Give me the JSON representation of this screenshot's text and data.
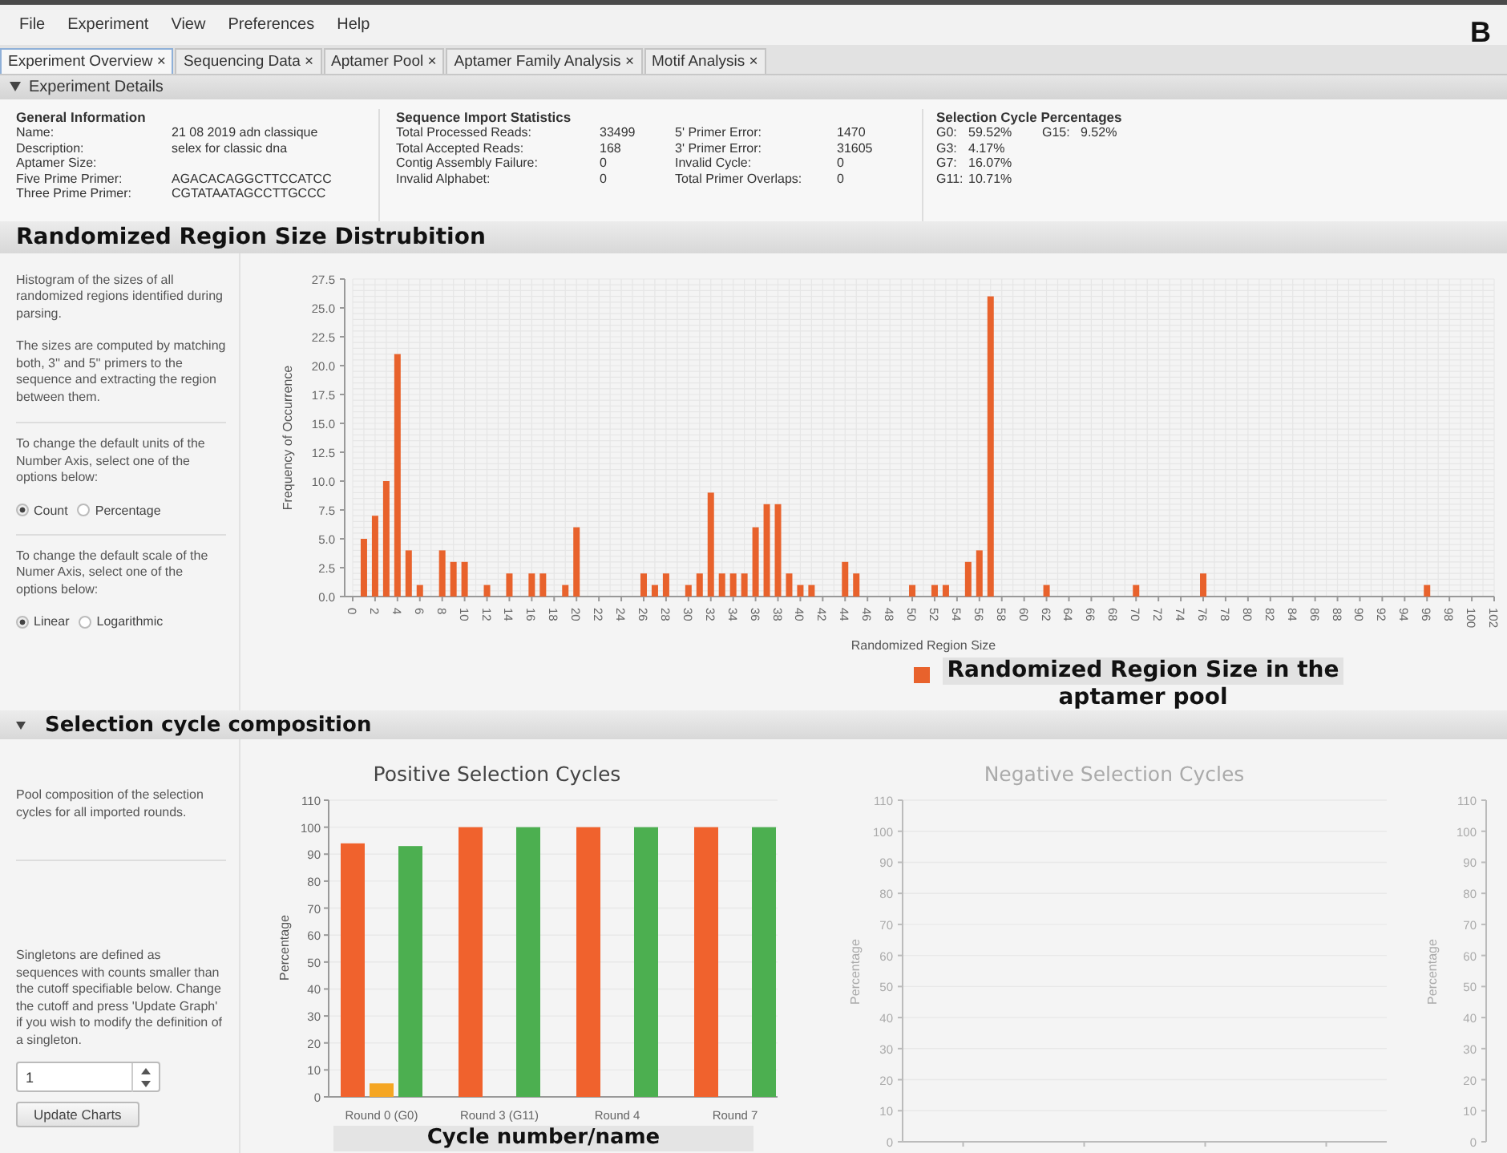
{
  "menu": [
    "File",
    "Experiment",
    "View",
    "Preferences",
    "Help"
  ],
  "panel_letter": "B",
  "tabs": [
    {
      "label": "Experiment Overview",
      "close": "×",
      "selected": true
    },
    {
      "label": "Sequencing Data",
      "close": "×",
      "selected": false
    },
    {
      "label": "Aptamer Pool",
      "close": "×",
      "selected": false
    },
    {
      "label": "Aptamer Family Analysis",
      "close": "×",
      "selected": false
    },
    {
      "label": "Motif Analysis",
      "close": "×",
      "selected": false
    }
  ],
  "details": {
    "title": "Experiment Details",
    "expanded": true,
    "general": {
      "title": "General Information",
      "rows": [
        {
          "label": "Name:",
          "value": "21 08 2019 adn classique"
        },
        {
          "label": "Description:",
          "value": "selex for classic dna"
        },
        {
          "label": "Aptamer Size:"
        },
        {
          "label": "Five Prime Primer:",
          "value": "AGACACAGGCTTCCATCC"
        },
        {
          "label": "Three Prime Primer:",
          "value": "CGTATAATAGCCTTGCCC"
        }
      ]
    },
    "import": {
      "title": "Sequence Import Statistics",
      "rows": [
        {
          "label": "Total Processed Reads:",
          "value": "33499",
          "label2": "5' Primer Error:",
          "value2": "1470"
        },
        {
          "label": "Total Accepted Reads:",
          "value": "168",
          "label2": "3' Primer Error:",
          "value2": "31605"
        },
        {
          "label": "Contig Assembly Failure:",
          "value": "0",
          "label2": "Invalid Cycle:",
          "value2": "0"
        },
        {
          "label": "Invalid Alphabet:",
          "value": "0",
          "label2": "Total Primer Overlaps:",
          "value2": "0"
        }
      ]
    },
    "cycles": {
      "title": "Selection Cycle Percentages",
      "rows": [
        {
          "label": "G0:",
          "value": "59.52%",
          "label2": "G15:",
          "value2": "9.52%"
        },
        {
          "label": "G3:",
          "value": "4.17%"
        },
        {
          "label": "G7:",
          "value": "16.07%"
        },
        {
          "label": "G11:",
          "value": "10.71%"
        }
      ]
    }
  },
  "region": {
    "title": "Randomized Region Size Distrubition",
    "paragraphs": [
      "Histogram of the sizes of all randomized regions identified during parsing.",
      "The sizes are computed by matching both, 3'' and 5'' primers to the sequence and extracting the region between them."
    ],
    "options": [
      {
        "text": "To change the default units of the Number Axis, select one of the options below:",
        "choices": [
          {
            "label": "Count",
            "selected": true
          },
          {
            "label": "Percentage",
            "selected": false
          }
        ]
      },
      {
        "text": "To change the default scale of the Numer Axis, select one of the options below:",
        "choices": [
          {
            "label": "Linear",
            "selected": true
          },
          {
            "label": "Logarithmic",
            "selected": false
          }
        ]
      }
    ],
    "chart_data": {
      "type": "bar",
      "grid": true,
      "xlabel": "Randomized Region Size",
      "ylabel": "Frequency of Occurrence",
      "x": [
        1,
        2,
        3,
        4,
        5,
        6,
        8,
        9,
        10,
        12,
        14,
        16,
        17,
        19,
        20,
        26,
        27,
        28,
        30,
        31,
        32,
        33,
        34,
        35,
        36,
        37,
        38,
        39,
        40,
        41,
        44,
        45,
        50,
        52,
        53,
        55,
        56,
        57,
        62,
        70,
        76,
        96
      ],
      "series": [
        {
          "name": "Randomized Region Size in the aptamer pool",
          "color": "#e8622c",
          "values": [
            5,
            7,
            10,
            21,
            4,
            1,
            4,
            3,
            3,
            1,
            2,
            2,
            2,
            1,
            6,
            2,
            1,
            2,
            1,
            2,
            9,
            2,
            2,
            2,
            6,
            8,
            8,
            2,
            1,
            1,
            3,
            2,
            1,
            1,
            1,
            3,
            4,
            26,
            1,
            1,
            2,
            1
          ]
        }
      ],
      "xlim": [
        0,
        102
      ],
      "xticks": [
        0,
        2,
        4,
        6,
        8,
        10,
        12,
        14,
        16,
        18,
        20,
        22,
        24,
        26,
        28,
        30,
        32,
        34,
        36,
        38,
        40,
        42,
        44,
        46,
        48,
        50,
        52,
        54,
        56,
        58,
        60,
        62,
        64,
        66,
        68,
        70,
        72,
        74,
        76,
        78,
        80,
        82,
        84,
        86,
        88,
        90,
        92,
        94,
        96,
        98,
        100,
        102
      ],
      "ylim": [
        0,
        27.5
      ],
      "yticks": [
        {
          "value": 0,
          "label": "0.0"
        },
        {
          "value": 2.5,
          "label": "2.5"
        },
        {
          "value": 5,
          "label": "5.0"
        },
        {
          "value": 7.5,
          "label": "7.5"
        },
        {
          "value": 10,
          "label": "10.0"
        },
        {
          "value": 12.5,
          "label": "12.5"
        },
        {
          "value": 15,
          "label": "15.0"
        },
        {
          "value": 17.5,
          "label": "17.5"
        },
        {
          "value": 20,
          "label": "20.0"
        },
        {
          "value": 22.5,
          "label": "22.5"
        },
        {
          "value": 25,
          "label": "25.0"
        },
        {
          "value": 27.5,
          "label": "27.5"
        }
      ]
    }
  },
  "composition": {
    "title": "Selection cycle composition",
    "expanded": true,
    "paragraphs": [
      "Pool composition of the selection cycles for all imported rounds.",
      "Singletons are defined as sequences with counts smaller than the cutoff specifiable below. Change the cutoff and press 'Update Graph' if you wish to modify the definition of a singleton."
    ],
    "cutoff": "1",
    "update_button": "Update Charts",
    "positive_chart": {
      "chart_data": {
        "type": "bar",
        "grid": true,
        "title": "Positive Selection Cycles",
        "xlabel": "Cycle number/name",
        "ylabel": "Percentage",
        "categories": [
          "Round 0 (G0)",
          "Round 3 (G11)",
          "Round 4",
          "Round 7"
        ],
        "series": [
          {
            "color": "#f0622d",
            "values": [
              94,
              100,
              100,
              100
            ]
          },
          {
            "color": "#f5a623",
            "values": [
              5,
              null,
              null,
              null
            ]
          },
          {
            "color": "#4caf50",
            "values": [
              93,
              100,
              100,
              100
            ]
          }
        ],
        "ylim": [
          0,
          110
        ],
        "yticks": [
          0,
          10,
          20,
          30,
          40,
          50,
          60,
          70,
          80,
          90,
          100,
          110
        ]
      }
    },
    "negative_chart": {
      "chart_data": {
        "type": "bar",
        "grid": true,
        "title": "Negative Selection Cycles",
        "categories": [
          null,
          null,
          null,
          null
        ],
        "ylabel": "Percentage",
        "ylim": [
          0,
          110
        ],
        "yticks": [
          0,
          10,
          20,
          30,
          40,
          50,
          60,
          70,
          80,
          90,
          100,
          110
        ],
        "y2label": "Percentage",
        "y2lim": [
          0,
          110
        ],
        "y2ticks": [
          0,
          10,
          20,
          30,
          40,
          50,
          60,
          70,
          80,
          90,
          100,
          110
        ]
      }
    }
  }
}
